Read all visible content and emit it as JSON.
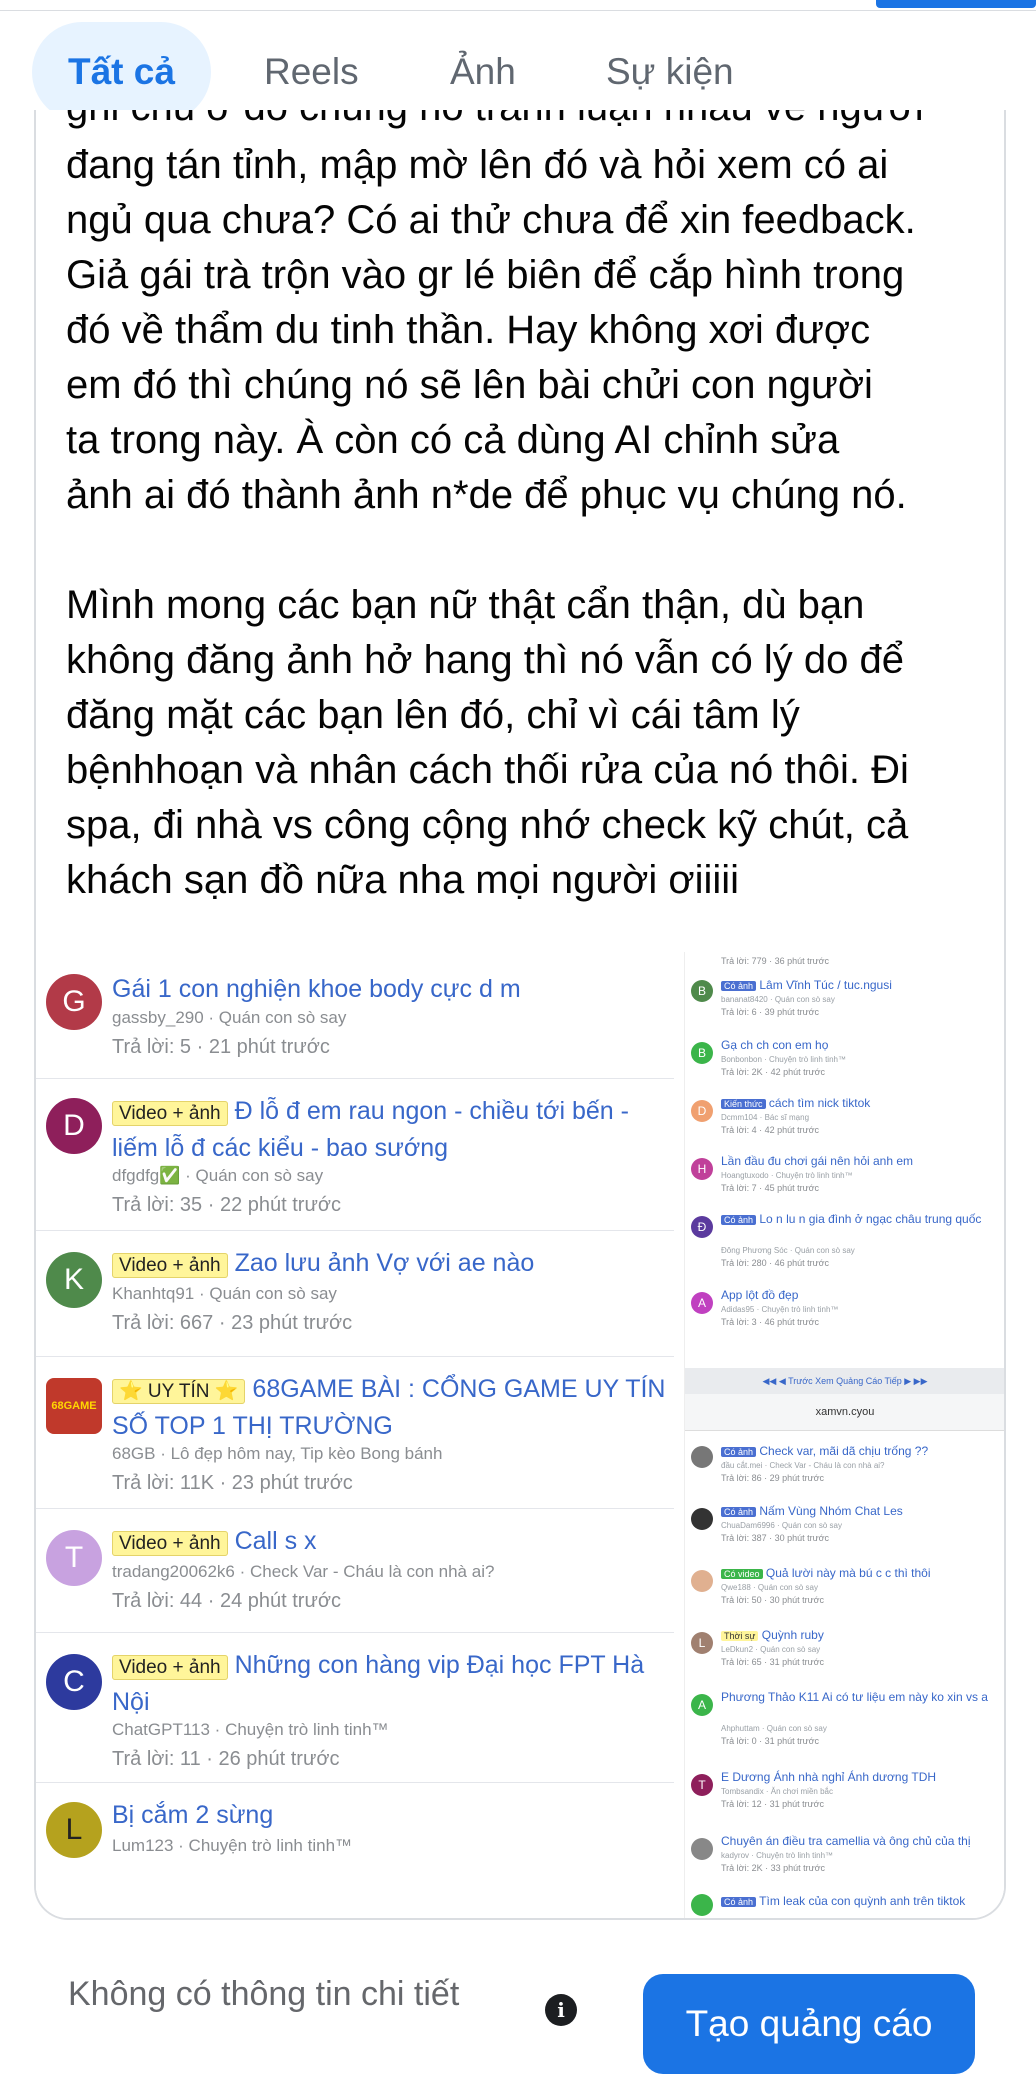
{
  "tabs": [
    "Tất cả",
    "Reels",
    "Ảnh",
    "Sự kiện"
  ],
  "post": {
    "cut_line": "ghi chú ở đó chúng nó tranh luận nhau về người nhà",
    "paragraph1": [
      "đang tán tỉnh, mập mờ lên đó và hỏi xem có ai",
      "ngủ qua chưa? Có ai thử chưa để xin feedback.",
      "Giả gái trà trộn vào gr lé biên để cắp hình trong",
      "đó về thẩm du tinh thần. Hay không xơi được",
      "em đó thì chúng nó sẽ lên bài chửi con người",
      "ta trong này. À còn có cả dùng AI chỉnh sửa",
      "ảnh ai đó thành ảnh n*de để phục vụ chúng nó."
    ],
    "paragraph2": [
      "Mình mong các bạn nữ thật cẩn thận, dù bạn",
      "không đăng ảnh hở hang thì nó vẫn có lý do để",
      "đăng mặt các bạn lên đó, chỉ vì cái tâm lý",
      "bệnhhoạn và nhân cách thối rửa của nó thôi. Đi",
      "spa, đi nhà vs công cộng nhớ check kỹ chút, cả",
      "khách sạn đồ nữa nha mọi người ơiiiii"
    ]
  },
  "forum_left": [
    {
      "avatar": "G",
      "color": "#b23a48",
      "tag": "",
      "title": "Gái 1 con nghiện khoe body cực d m",
      "meta": "gassby_290 · Quán con sò say",
      "reply": "Trả lời: 5 · 21 phút trước"
    },
    {
      "avatar": "D",
      "color": "#8e1f5b",
      "tag": "Video + ảnh",
      "title": "Đ lỗ đ em rau ngon - chiều tới bến - liếm lỗ đ các kiểu - bao sướng",
      "meta": "dfgdfg✅ · Quán con sò say",
      "reply": "Trả lời: 35 · 22 phút trước"
    },
    {
      "avatar": "K",
      "color": "#4f8a4b",
      "tag": "Video + ảnh",
      "title": "Zao lưu ảnh Vợ với ae nào",
      "meta": "Khanhtq91 · Quán con sò say",
      "reply": "Trả lời: 667 · 23 phút trước"
    },
    {
      "avatar": "68GAME",
      "color": "#c0392b",
      "tag": "⭐ UY TÍN ⭐",
      "title": "68GAME BÀI : CỔNG GAME UY TÍN SỐ TOP 1 THỊ TRƯỜNG",
      "meta": "68GB · Lô đẹp hôm nay, Tip kèo Bong bánh",
      "reply": "Trả lời: 11K · 23 phút trước"
    },
    {
      "avatar": "T",
      "color": "#c8a2e0",
      "tag": "Video + ảnh",
      "title": "Call s x",
      "meta": "tradang20062k6 · Check Var - Cháu là con nhà ai?",
      "reply": "Trả lời: 44 · 24 phút trước"
    },
    {
      "avatar": "C",
      "color": "#2d3a9e",
      "tag": "Video + ảnh",
      "title": "Những con hàng vip Đại học FPT Hà Nội",
      "meta": "ChatGPT113 · Chuyện trò linh tinh™",
      "reply": "Trả lời: 11 · 26 phút trước"
    },
    {
      "avatar": "L",
      "color": "#b5a21e",
      "tag": "",
      "title": "Bị cắm 2 sừng",
      "meta": "Lum123 · Chuyện trò linh tinh™",
      "reply": ""
    }
  ],
  "forum_right": {
    "top_reply": "Trả lời: 779 · 36 phút trước",
    "items": [
      {
        "avatar": "B",
        "color": "#4f8a4b",
        "tag": "Có ảnh",
        "title": "Lâm Vĩnh Túc / tuc.ngusi",
        "meta": "bananat8420 · Quán con sò say",
        "reply": "Trả lời: 6 · 39 phút trước"
      },
      {
        "avatar": "B",
        "color": "#3bb54a",
        "tag": "",
        "title": "Gạ ch ch con em họ",
        "meta": "Bonbonbon · Chuyện trò linh tinh™",
        "reply": "Trả lời: 2K · 42 phút trước"
      },
      {
        "avatar": "D",
        "color": "#f0a070",
        "tag": "Kiến thức",
        "title": "cách tìm nick tiktok",
        "meta": "Dcmm104 · Bác sĩ mạng",
        "reply": "Trả lời: 4 · 42 phút trước"
      },
      {
        "avatar": "H",
        "color": "#c0409a",
        "tag": "",
        "title": "Lần đầu đu chơi gái nên hỏi anh em",
        "meta": "Hoangtuxodo · Chuyện trò linh tinh™",
        "reply": "Trả lời: 7 · 45 phút trước"
      },
      {
        "avatar": "Đ",
        "color": "#5b3a9e",
        "tag": "Có ảnh",
        "title": "Lo n lu n gia đình ở ngạc châu trung quốc",
        "meta": "Đông Phương Sóc · Quán con sò say",
        "reply": "Trả lời: 280 · 46 phút trước"
      },
      {
        "avatar": "A",
        "color": "#c040c0",
        "tag": "",
        "title": "App lột đồ đẹp",
        "meta": "Adidas95 · Chuyện trò linh tinh™",
        "reply": "Trả lời: 3 · 46 phút trước"
      }
    ],
    "nav": "◀◀   ◀ Trước   Xem Quảng Cáo   Tiếp ▶   ▶▶",
    "url": "xamvn.cyou",
    "items2": [
      {
        "avatar": "",
        "color": "#777777",
        "tag": "Có ảnh",
        "title": "Check var, mãi dã chịu trống ??",
        "meta": "đầu cắt.mei · Check Var - Cháu là con nhà ai?",
        "reply": "Trả lời: 86 · 29 phút trước"
      },
      {
        "avatar": "",
        "color": "#333333",
        "tag": "Có ảnh",
        "title": "Nấm Vùng Nhóm Chat Les",
        "meta": "ChuaDam6996 · Quán con sò say",
        "reply": "Trả lời: 387 · 30 phút trước"
      },
      {
        "avatar": "",
        "color": "#e0b090",
        "tag": "Có video",
        "title": "Quả lười này mà bú c c thì thôi",
        "meta": "Qwe188 · Quán con sò say",
        "reply": "Trả lời: 50 · 30 phút trước"
      },
      {
        "avatar": "L",
        "color": "#a08070",
        "tag": "Thời sự",
        "title": "Quỳnh ruby",
        "meta": "LeDkun2 · Quán con sò say",
        "reply": "Trả lời: 65 · 31 phút trước"
      },
      {
        "avatar": "A",
        "color": "#3bb54a",
        "tag": "",
        "title": "Phương Thảo K11 Ai có tư liệu em này ko xin vs a",
        "meta": "Ahphuttam · Quán con sò say",
        "reply": "Trả lời: 0 · 31 phút trước"
      },
      {
        "avatar": "T",
        "color": "#8e1f5b",
        "tag": "",
        "title": "E Dương Ánh nhà nghỉ Ánh dương TDH",
        "meta": "Tombsandix · Ăn chơi miền bắc",
        "reply": "Trả lời: 12 · 31 phút trước"
      },
      {
        "avatar": "",
        "color": "#888888",
        "tag": "",
        "title": "Chuyên án điều tra camellia và ông chủ của thị",
        "meta": "kadyrov · Chuyện trò linh tinh™",
        "reply": "Trả lời: 2K · 33 phút trước"
      },
      {
        "avatar": "",
        "color": "#3bb54a",
        "tag": "Có ảnh",
        "title": "Tìm leak của con quỳnh anh trên tiktok",
        "meta": "",
        "reply": ""
      }
    ]
  },
  "footer": {
    "text": "Không có thông tin chi tiết",
    "info_icon": "i",
    "cta": "Tạo quảng cáo"
  }
}
